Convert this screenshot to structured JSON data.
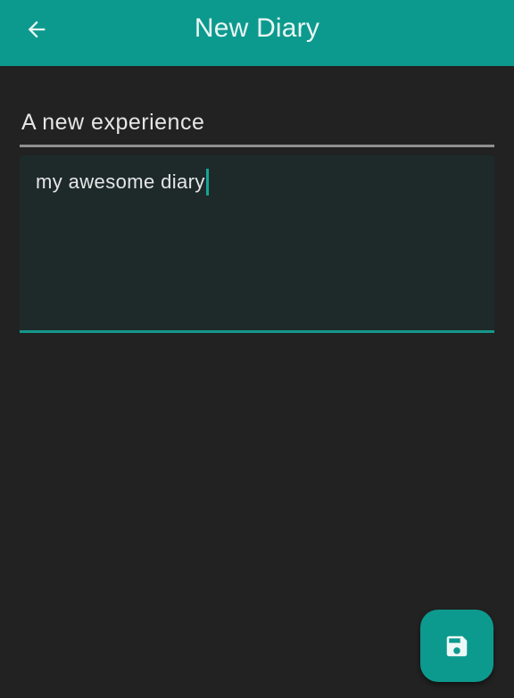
{
  "app_bar": {
    "title": "New Diary",
    "back_icon": "arrow-back-icon",
    "color": "#0d9a8e"
  },
  "form": {
    "title_field": {
      "value": "A new experience"
    },
    "body_field": {
      "value": "my awesome diary"
    }
  },
  "fab": {
    "icon": "save-icon",
    "color": "#0d9a8e"
  },
  "colors": {
    "background": "#222222",
    "accent": "#0d9a8e",
    "text": "#e6e6e6"
  }
}
